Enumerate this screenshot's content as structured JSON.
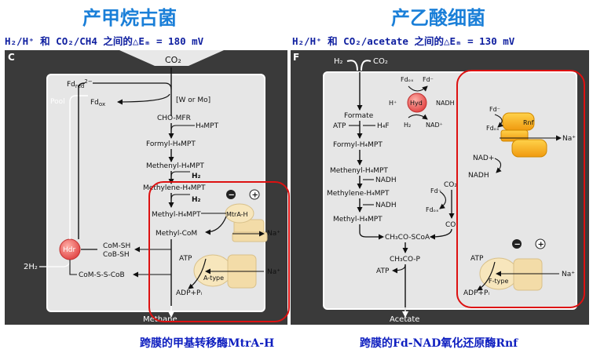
{
  "header": {
    "left_title": "产甲烷古菌",
    "right_title": "产乙酸细菌",
    "left_sub": "H₂/H⁺ 和 CO₂/CH4 之间的△Eₘ = 180 mV",
    "right_sub": "H₂/H⁺ 和 CO₂/acetate 之间的△Eₘ = 130 mV"
  },
  "captions": {
    "left": "跨膜的甲基转移酶MtrA-H",
    "right": "跨膜的Fd-NAD氧化还原酶Rnf"
  },
  "left_panel": {
    "letter": "C",
    "co2": "CO₂",
    "fd_red": "Fdᵣₑ𝒹²⁻",
    "fd_red_plain": "Fd",
    "fd_red_sub": "red",
    "fd_red_sup": "2−",
    "fd_ox": "Fd",
    "fd_ox_sub": "ox",
    "pool": "Pool",
    "w_mo": "[W or Mo]",
    "cho_mfr": "CHO-MFR",
    "h4mpt_1": "H₄MPT",
    "formyl": "Formyl-H₄MPT",
    "methenyl": "Methenyl-H₄MPT",
    "h2_a": "H₂",
    "methylene": "Methylene-H₄MPT",
    "h2_b": "H₂",
    "methyl_h4mpt": "Methyl-H₄MPT",
    "mtra": "MtrA-H",
    "methyl_com": "Methyl-CoM",
    "na_1": "Na⁺",
    "hdr": "Hdr",
    "com_sh": "CoM-SH",
    "cob_sh": "CoB-SH",
    "two_h2": "2H₂",
    "comscob": "CoM-S-S-CoB",
    "atp": "ATP",
    "atype": "A-type",
    "na_2": "Na⁺",
    "adp": "ADP+Pᵢ",
    "methane": "Methane",
    "minus": "−",
    "plus": "+"
  },
  "right_panel": {
    "letter": "F",
    "h2": "H₂",
    "co2": "CO₂",
    "fd_ox_a": "Fdₒₓ",
    "fd_red_a": "Fd⁻",
    "hplus": "H⁺",
    "hyd": "Hyd",
    "nadh_a": "NADH",
    "h2_b": "H₂",
    "nad_a": "NAD⁺",
    "formate": "Formate",
    "atp_1": "ATP",
    "h4f": "H₄F",
    "formyl": "Formyl-H₄MPT",
    "methenyl": "Methenyl-H₄MPT",
    "nadh_b": "NADH",
    "methylene": "Methylene-H₄MPT",
    "nadh_c": "NADH",
    "methyl": "Methyl-H₄MPT",
    "fd_red_b": "Fd⁻",
    "fd_ox_b": "Fdₒₓ",
    "co2_b": "CO₂",
    "co": "CO",
    "acetyl": "CH₃CO-SCoA",
    "acp": "CH₃CO-P",
    "atp_2": "ATP",
    "acetate": "Acetate",
    "fd_red_c": "Fd⁻",
    "fd_ox_c": "Fdₒₓ",
    "rnf": "Rnf",
    "na_1": "Na⁺",
    "nad_b": "NAD+",
    "nadh_d": "NADH",
    "atp_3": "ATP",
    "ftype": "F-type",
    "na_2": "Na⁺",
    "adp": "ADP+Pᵢ",
    "minus": "−",
    "plus": "+"
  }
}
